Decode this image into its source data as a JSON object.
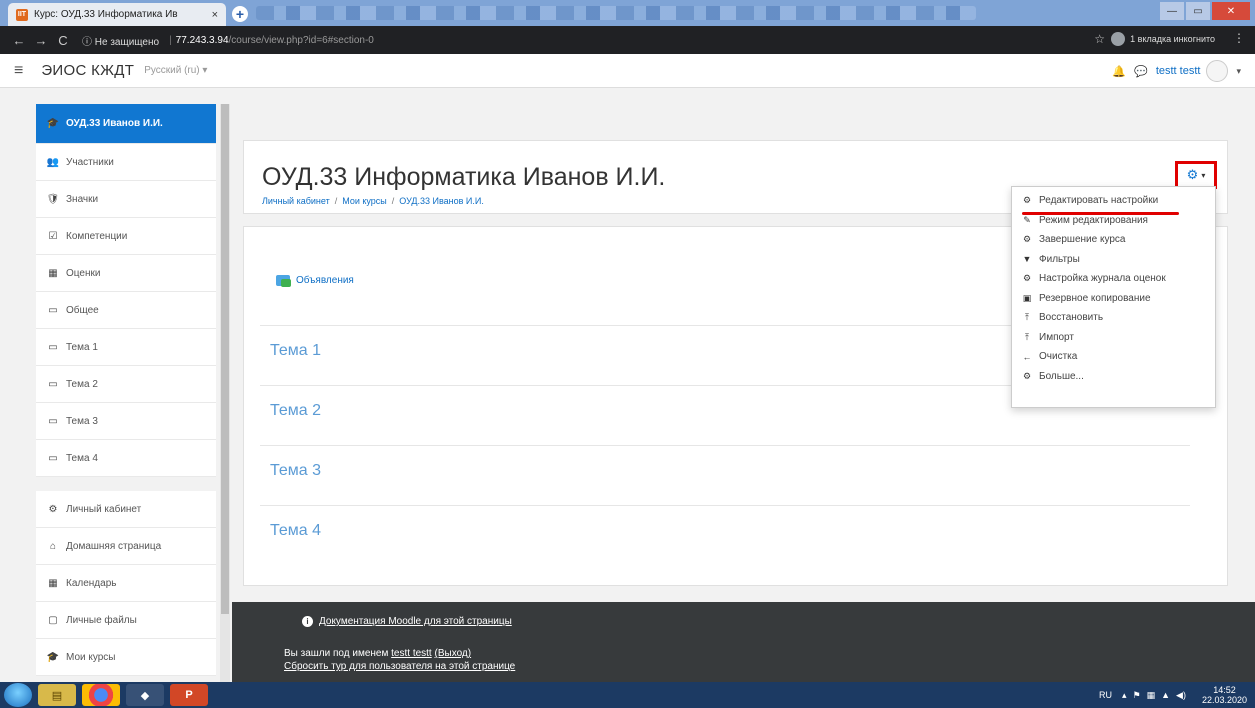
{
  "browser": {
    "tab_title": "Курс: ОУД.33 Информатика Ив",
    "tab_favicon": "IIT",
    "tab_close": "×",
    "new_tab": "+",
    "security_label": "ⓘ Не защищено",
    "host": "77.243.3.94",
    "path": "/course/view.php?id=6#section-0",
    "incognito_label": "1 вкладка инкогнито",
    "back": "←",
    "forward": "→",
    "reload": "C"
  },
  "navbar": {
    "brand": "ЭИОС КЖДТ",
    "language": "Русский (ru) ▾",
    "username": "testt testt"
  },
  "drawer": {
    "course_item": "ОУД.33 Иванов И.И.",
    "items_course": [
      {
        "label": "Участники",
        "icon": "users-icon",
        "glyph": "👥"
      },
      {
        "label": "Значки",
        "icon": "badge-icon",
        "glyph": "🛡"
      },
      {
        "label": "Компетенции",
        "icon": "check-square-icon",
        "glyph": "☑"
      },
      {
        "label": "Оценки",
        "icon": "table-icon",
        "glyph": "▦"
      },
      {
        "label": "Общее",
        "icon": "folder-icon",
        "glyph": "▭"
      },
      {
        "label": "Тема 1",
        "icon": "folder-icon",
        "glyph": "▭"
      },
      {
        "label": "Тема 2",
        "icon": "folder-icon",
        "glyph": "▭"
      },
      {
        "label": "Тема 3",
        "icon": "folder-icon",
        "glyph": "▭"
      },
      {
        "label": "Тема 4",
        "icon": "folder-icon",
        "glyph": "▭"
      }
    ],
    "items_site": [
      {
        "label": "Личный кабинет",
        "icon": "dashboard-icon",
        "glyph": "⚙"
      },
      {
        "label": "Домашняя страница",
        "icon": "home-icon",
        "glyph": "⌂"
      },
      {
        "label": "Календарь",
        "icon": "calendar-icon",
        "glyph": "▦"
      },
      {
        "label": "Личные файлы",
        "icon": "file-icon",
        "glyph": "▢"
      },
      {
        "label": "Мои курсы",
        "icon": "graduation-cap-icon",
        "glyph": "🎓"
      }
    ]
  },
  "header": {
    "title": "ОУД.33 Информатика Иванов И.И.",
    "breadcrumb": [
      "Личный кабинет",
      "Мои курсы",
      "ОУД.33 Иванов И.И."
    ]
  },
  "content": {
    "announcements": "Объявления",
    "sections": [
      "Тема 1",
      "Тема 2",
      "Тема 3",
      "Тема 4"
    ]
  },
  "dropdown": {
    "items": [
      {
        "label": "Редактировать настройки",
        "icon": "gear-icon",
        "glyph": "⚙"
      },
      {
        "label": "Режим редактирования",
        "icon": "pencil-icon",
        "glyph": "✎"
      },
      {
        "label": "Завершение курса",
        "icon": "gear-icon",
        "glyph": "⚙"
      },
      {
        "label": "Фильтры",
        "icon": "filter-icon",
        "glyph": "▼"
      },
      {
        "label": "Настройка журнала оценок",
        "icon": "gear-icon",
        "glyph": "⚙"
      },
      {
        "label": "Резервное копирование",
        "icon": "backup-icon",
        "glyph": "▣"
      },
      {
        "label": "Восстановить",
        "icon": "upload-icon",
        "glyph": "⤒"
      },
      {
        "label": "Импорт",
        "icon": "import-icon",
        "glyph": "⤒"
      },
      {
        "label": "Очистка",
        "icon": "arrow-left-icon",
        "glyph": "←"
      },
      {
        "label": "Больше...",
        "icon": "gear-icon",
        "glyph": "⚙"
      }
    ]
  },
  "footer": {
    "docs_link": "Документация Moodle для этой страницы",
    "logged_in_prefix": "Вы зашли под именем ",
    "logged_in_user": "testt testt",
    "logout": "(Выход)",
    "reset_tour": "Сбросить тур для пользователя на этой странице"
  },
  "taskbar": {
    "language": "RU",
    "time": "14:52",
    "date": "22.03.2020"
  }
}
